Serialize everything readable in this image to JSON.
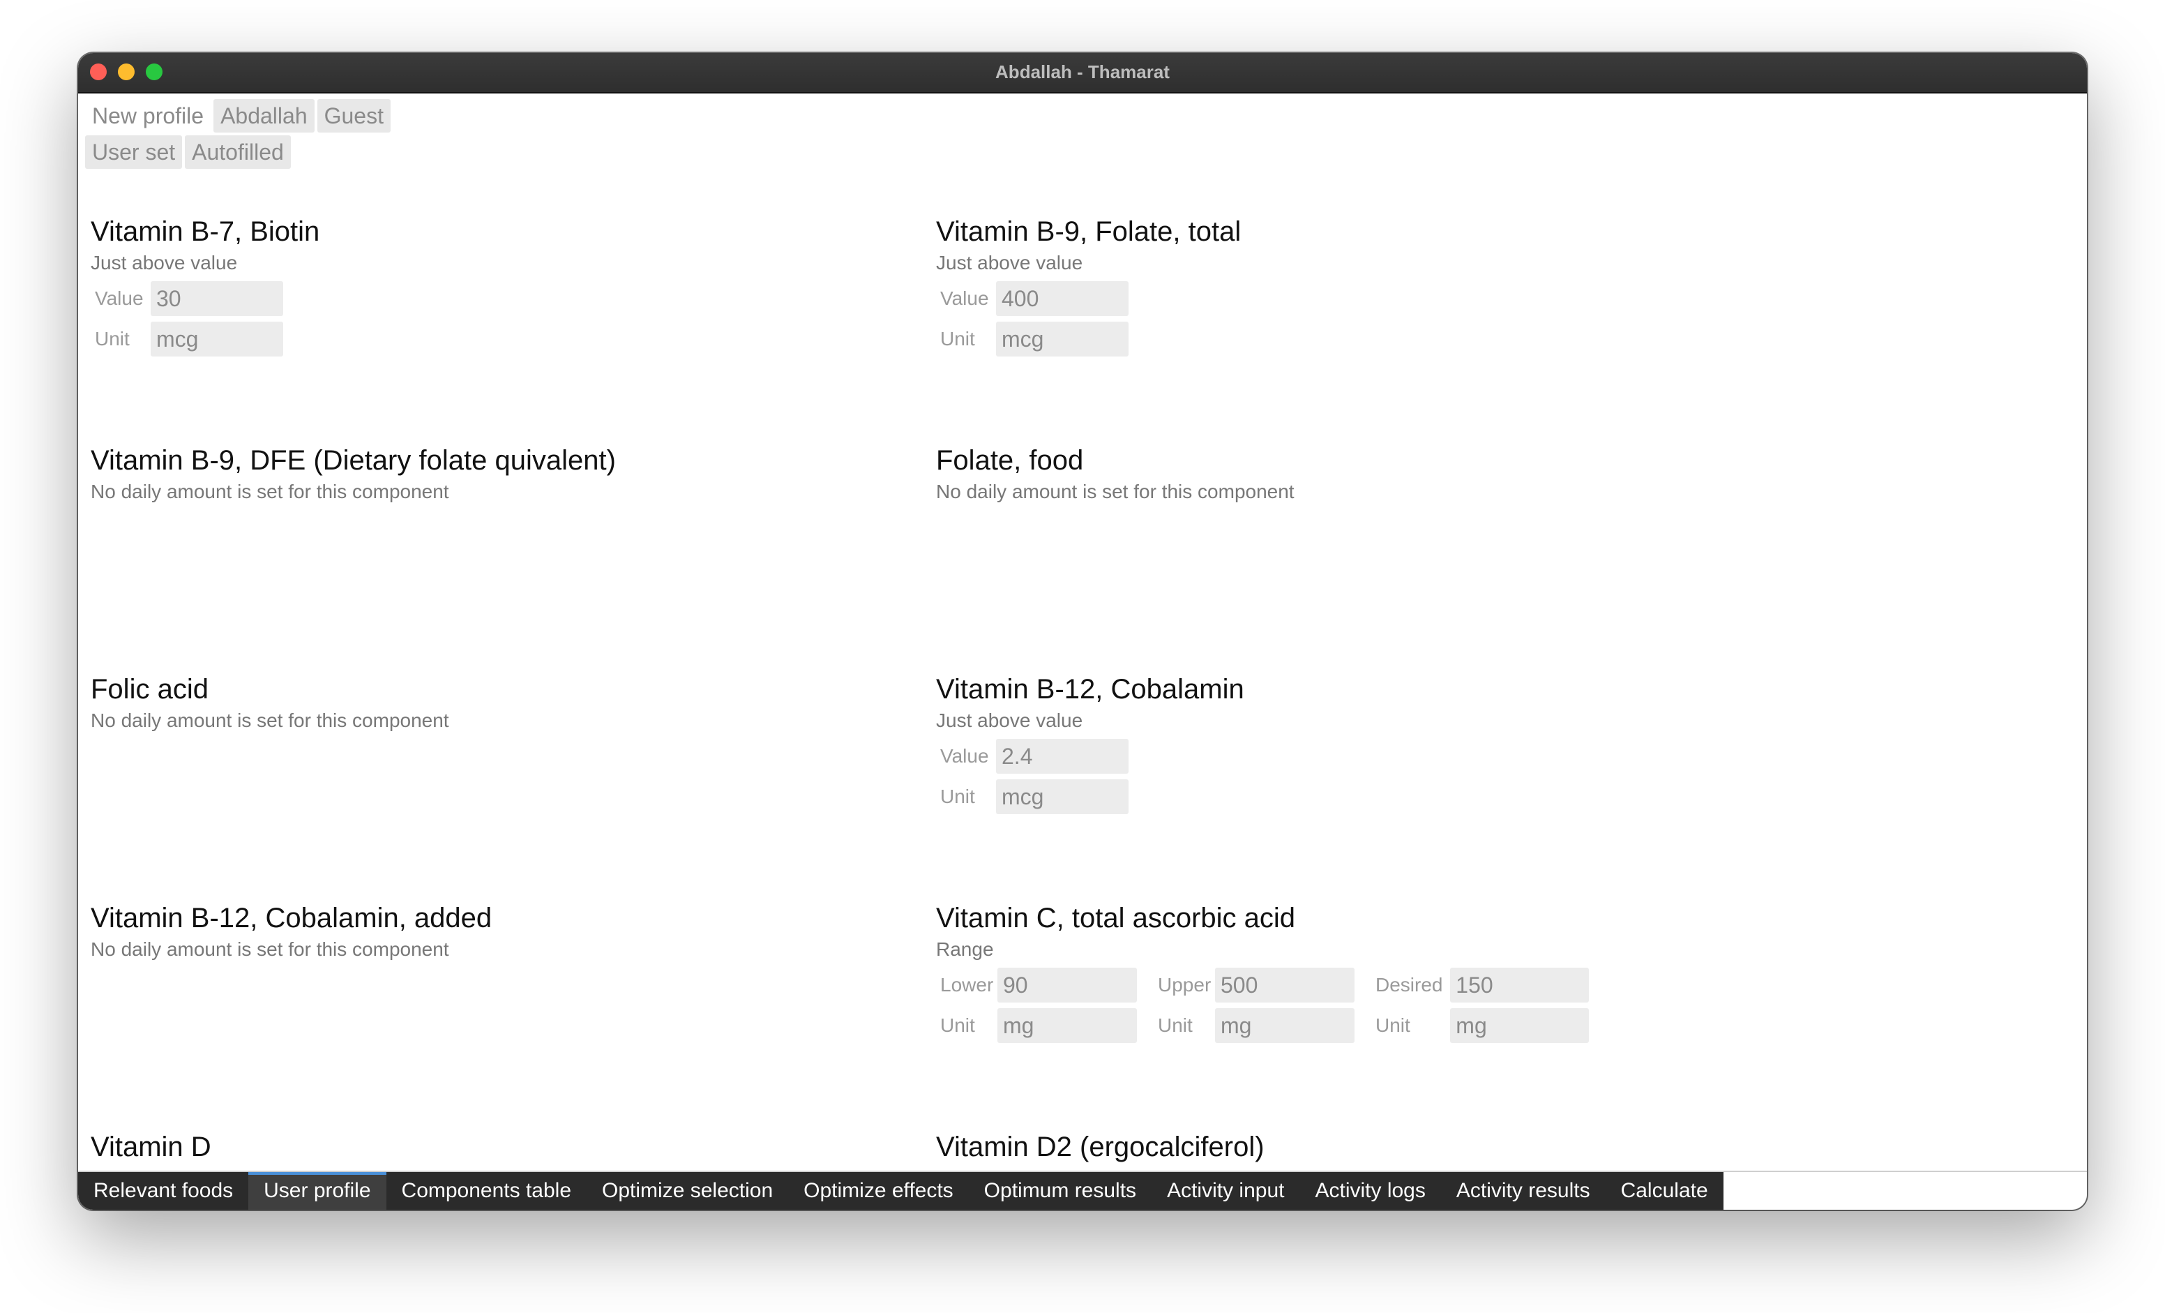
{
  "window": {
    "title": "Abdallah - Thamarat"
  },
  "profiles": [
    "New profile",
    "Abdallah",
    "Guest"
  ],
  "modes": [
    "User set",
    "Autofilled"
  ],
  "components": [
    {
      "title": "Vitamin B-7, Biotin",
      "subtitle": "Just above value",
      "fields": [
        {
          "label": "Value",
          "value": "30"
        },
        {
          "label": "Unit",
          "value": "mcg"
        }
      ]
    },
    {
      "title": "Vitamin B-9, Folate, total",
      "subtitle": "Just above value",
      "fields": [
        {
          "label": "Value",
          "value": "400"
        },
        {
          "label": "Unit",
          "value": "mcg"
        }
      ]
    },
    {
      "title": "Vitamin B-9, DFE (Dietary folate quivalent)",
      "subtitle": "No daily amount is set for this component"
    },
    {
      "title": "Folate, food",
      "subtitle": "No daily amount is set for this component"
    },
    {
      "title": "Folic acid",
      "subtitle": "No daily amount is set for this component"
    },
    {
      "title": "Vitamin B-12, Cobalamin",
      "subtitle": "Just above value",
      "fields": [
        {
          "label": "Value",
          "value": "2.4"
        },
        {
          "label": "Unit",
          "value": "mcg"
        }
      ]
    },
    {
      "title": "Vitamin B-12, Cobalamin, added",
      "subtitle": "No daily amount is set for this component"
    },
    {
      "title": "Vitamin C, total ascorbic acid",
      "subtitle": "Range",
      "range": {
        "lower": {
          "label": "Lower",
          "value": "90",
          "unit_label": "Unit",
          "unit": "mg"
        },
        "upper": {
          "label": "Upper",
          "value": "500",
          "unit_label": "Unit",
          "unit": "mg"
        },
        "desired": {
          "label": "Desired",
          "value": "150",
          "unit_label": "Unit",
          "unit": "mg"
        }
      }
    },
    {
      "title": "Vitamin D"
    },
    {
      "title": "Vitamin D2 (ergocalciferol)"
    }
  ],
  "tabs": [
    "Relevant foods",
    "User profile",
    "Components table",
    "Optimize selection",
    "Optimize effects",
    "Optimum results",
    "Activity input",
    "Activity logs",
    "Activity results",
    "Calculate"
  ],
  "active_tab": "User profile"
}
